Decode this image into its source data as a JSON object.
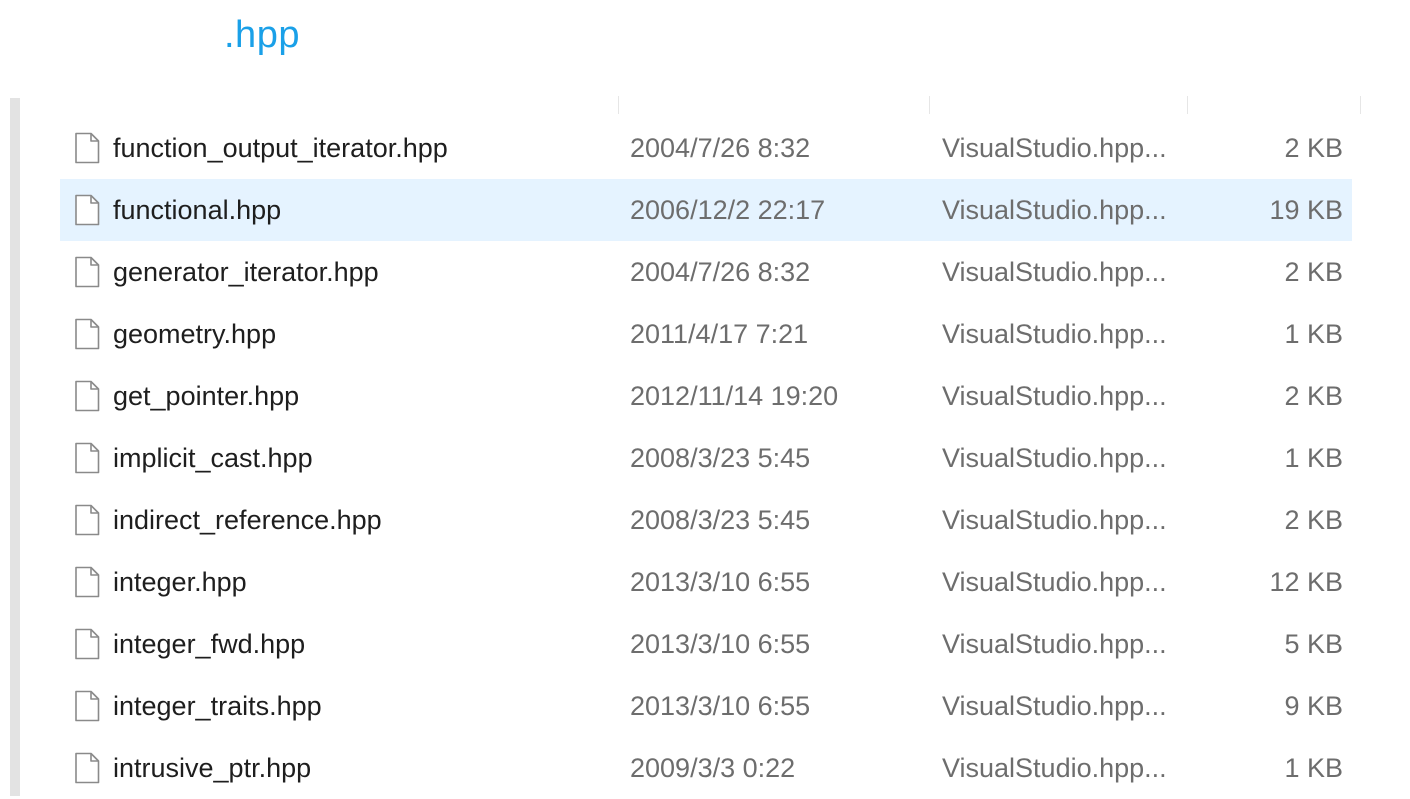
{
  "title": ".hpp",
  "files": [
    {
      "name": "function_output_iterator.hpp",
      "date": "2004/7/26 8:32",
      "type": "VisualStudio.hpp...",
      "size": "2 KB",
      "selected": false
    },
    {
      "name": "functional.hpp",
      "date": "2006/12/2 22:17",
      "type": "VisualStudio.hpp...",
      "size": "19 KB",
      "selected": true
    },
    {
      "name": "generator_iterator.hpp",
      "date": "2004/7/26 8:32",
      "type": "VisualStudio.hpp...",
      "size": "2 KB",
      "selected": false
    },
    {
      "name": "geometry.hpp",
      "date": "2011/4/17 7:21",
      "type": "VisualStudio.hpp...",
      "size": "1 KB",
      "selected": false
    },
    {
      "name": "get_pointer.hpp",
      "date": "2012/11/14 19:20",
      "type": "VisualStudio.hpp...",
      "size": "2 KB",
      "selected": false
    },
    {
      "name": "implicit_cast.hpp",
      "date": "2008/3/23 5:45",
      "type": "VisualStudio.hpp...",
      "size": "1 KB",
      "selected": false
    },
    {
      "name": "indirect_reference.hpp",
      "date": "2008/3/23 5:45",
      "type": "VisualStudio.hpp...",
      "size": "2 KB",
      "selected": false
    },
    {
      "name": "integer.hpp",
      "date": "2013/3/10 6:55",
      "type": "VisualStudio.hpp...",
      "size": "12 KB",
      "selected": false
    },
    {
      "name": "integer_fwd.hpp",
      "date": "2013/3/10 6:55",
      "type": "VisualStudio.hpp...",
      "size": "5 KB",
      "selected": false
    },
    {
      "name": "integer_traits.hpp",
      "date": "2013/3/10 6:55",
      "type": "VisualStudio.hpp...",
      "size": "9 KB",
      "selected": false
    },
    {
      "name": "intrusive_ptr.hpp",
      "date": "2009/3/3 0:22",
      "type": "VisualStudio.hpp...",
      "size": "1 KB",
      "selected": false
    }
  ],
  "colors": {
    "title": "#1aa0e8",
    "selected_row": "#e5f3ff",
    "name_text": "#1e1e1e",
    "detail_text": "#6d6d6d"
  },
  "icons": {
    "file": "file-icon"
  }
}
